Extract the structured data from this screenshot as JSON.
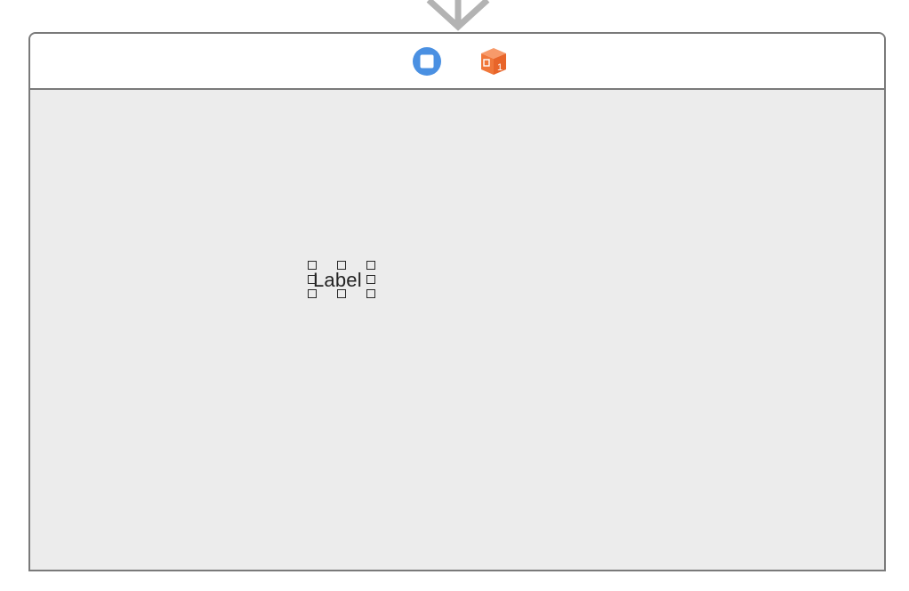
{
  "scene": {
    "entry_arrow_icon": "entry-point-arrow-icon",
    "dock": {
      "items": [
        {
          "name": "view-controller",
          "icon": "view-controller-icon",
          "color": "#4a90e2"
        },
        {
          "name": "first-responder",
          "icon": "first-responder-cube-icon",
          "color": "#f0773a",
          "badge": "1"
        }
      ]
    },
    "content": {
      "label": {
        "text": "Label",
        "selected": true,
        "text_color": "#222222"
      }
    },
    "colors": {
      "border": "#7a7a7a",
      "background": "#ececec",
      "dock_background": "#ffffff",
      "arrow": "#b3b3b3"
    }
  }
}
